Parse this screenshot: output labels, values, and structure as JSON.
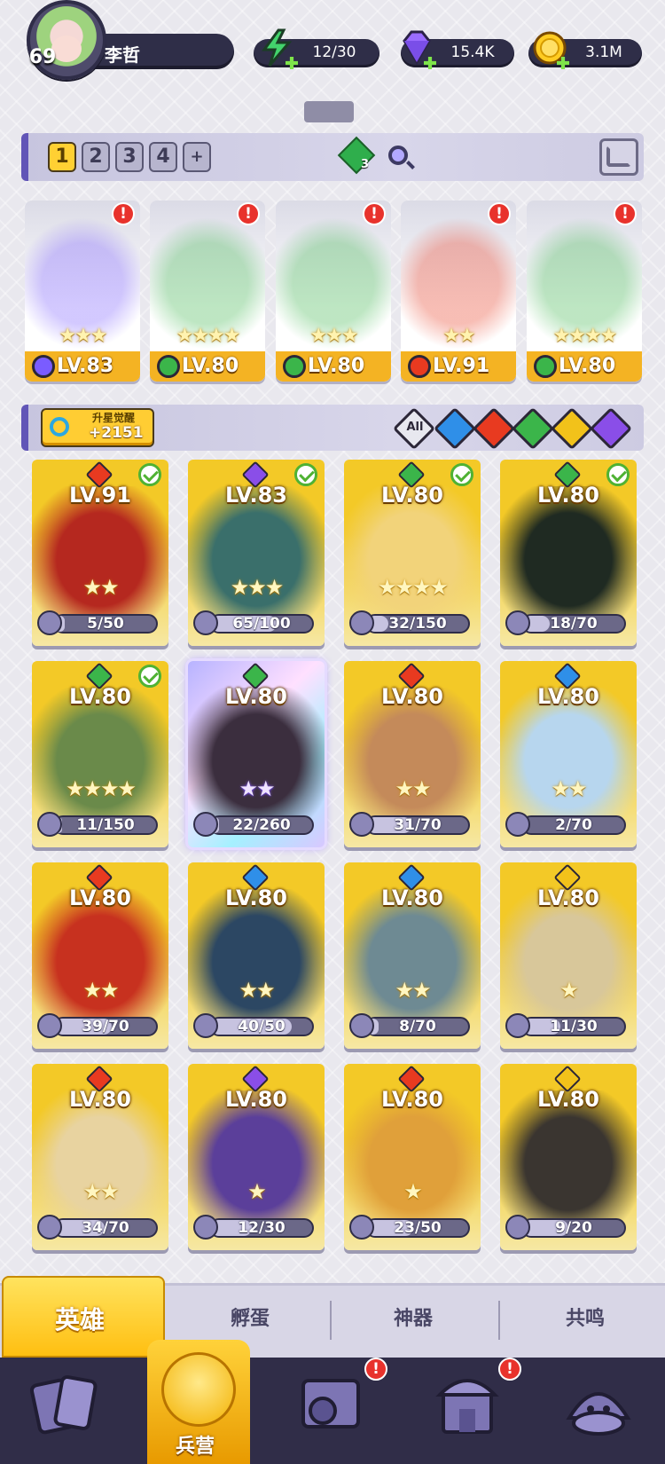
{
  "player": {
    "level": "69",
    "name": "李哲"
  },
  "resources": {
    "energy": "12/30",
    "gems": "15.4K",
    "gold": "3.1M"
  },
  "teams": {
    "tabs": [
      "1",
      "2",
      "3",
      "4",
      "+"
    ],
    "active_index": 0,
    "green_gem_count": "3"
  },
  "team_members": [
    {
      "level": "LV.83",
      "stars": "★★★",
      "element": "dark",
      "color": "#7a5cff",
      "alert": "!"
    },
    {
      "level": "LV.80",
      "stars": "★★★★",
      "element": "nature",
      "color": "#3bb54a",
      "alert": "!"
    },
    {
      "level": "LV.80",
      "stars": "★★★",
      "element": "nature",
      "color": "#3bb54a",
      "alert": "!"
    },
    {
      "level": "LV.91",
      "stars": "★★",
      "element": "fire",
      "color": "#e83a20",
      "alert": "!"
    },
    {
      "level": "LV.80",
      "stars": "★★★★",
      "element": "nature",
      "color": "#3bb54a",
      "alert": "!"
    }
  ],
  "awaken": {
    "label": "升星觉醒",
    "value": "+2151"
  },
  "filters": {
    "all_label": "All",
    "elements": [
      {
        "name": "water",
        "color": "#2f8fe8"
      },
      {
        "name": "fire",
        "color": "#e83a20"
      },
      {
        "name": "nature",
        "color": "#3bb54a"
      },
      {
        "name": "light",
        "color": "#f2c21a"
      },
      {
        "name": "dark",
        "color": "#8a4ee8"
      }
    ]
  },
  "heroes": [
    {
      "level": "LV.91",
      "element_color": "#e83a20",
      "stars": "★★",
      "shards": "5/50",
      "fraction": 0.1,
      "checked": true,
      "art": "#b5281f"
    },
    {
      "level": "LV.83",
      "element_color": "#8a4ee8",
      "stars": "★★★",
      "shards": "65/100",
      "fraction": 0.65,
      "checked": true,
      "art": "#3a6f6b"
    },
    {
      "level": "LV.80",
      "element_color": "#3bb54a",
      "stars": "★★★★",
      "shards": "32/150",
      "fraction": 0.21,
      "checked": true,
      "art": "#f2d37a"
    },
    {
      "level": "LV.80",
      "element_color": "#3bb54a",
      "stars": "",
      "shards": "18/70",
      "fraction": 0.26,
      "checked": true,
      "art": "#1f2a22"
    },
    {
      "level": "LV.80",
      "element_color": "#3bb54a",
      "stars": "★★★★",
      "shards": "11/150",
      "fraction": 0.07,
      "checked": true,
      "art": "#6a8a4a"
    },
    {
      "level": "LV.80",
      "element_color": "#3bb54a",
      "stars": "★★",
      "shards": "22/260",
      "fraction": 0.08,
      "checked": false,
      "rainbow": true,
      "art": "#3b2e3e"
    },
    {
      "level": "LV.80",
      "element_color": "#e83a20",
      "stars": "★★",
      "shards": "31/70",
      "fraction": 0.44,
      "checked": false,
      "art": "#c48a5a"
    },
    {
      "level": "LV.80",
      "element_color": "#2f8fe8",
      "stars": "★★",
      "shards": "2/70",
      "fraction": 0.03,
      "checked": false,
      "art": "#b7d6ee"
    },
    {
      "level": "LV.80",
      "element_color": "#e83a20",
      "stars": "★★",
      "shards": "39/70",
      "fraction": 0.56,
      "checked": false,
      "art": "#c7311f"
    },
    {
      "level": "LV.80",
      "element_color": "#2f8fe8",
      "stars": "★★",
      "shards": "40/50",
      "fraction": 0.8,
      "checked": false,
      "art": "#2c4763"
    },
    {
      "level": "LV.80",
      "element_color": "#2f8fe8",
      "stars": "★★",
      "shards": "8/70",
      "fraction": 0.11,
      "checked": false,
      "art": "#6e8a93"
    },
    {
      "level": "LV.80",
      "element_color": "#f2c21a",
      "stars": "★",
      "shards": "11/30",
      "fraction": 0.37,
      "checked": false,
      "art": "#d8c79a"
    },
    {
      "level": "LV.80",
      "element_color": "#e83a20",
      "stars": "★★",
      "shards": "34/70",
      "fraction": 0.49,
      "checked": false,
      "art": "#e8d3a0"
    },
    {
      "level": "LV.80",
      "element_color": "#8a4ee8",
      "stars": "★",
      "shards": "12/30",
      "fraction": 0.4,
      "checked": false,
      "art": "#5b3f9a"
    },
    {
      "level": "LV.80",
      "element_color": "#e83a20",
      "stars": "★",
      "shards": "23/50",
      "fraction": 0.46,
      "checked": false,
      "art": "#e0a03a"
    },
    {
      "level": "LV.80",
      "element_color": "#f2c21a",
      "stars": "",
      "shards": "9/20",
      "fraction": 0.45,
      "checked": false,
      "art": "#3a3530"
    }
  ],
  "subtabs": {
    "heroes": "英雄",
    "hatch": "孵蛋",
    "artifacts": "神器",
    "resonance": "共鸣"
  },
  "bottom_nav": {
    "barracks": "兵营",
    "alert": "!"
  }
}
